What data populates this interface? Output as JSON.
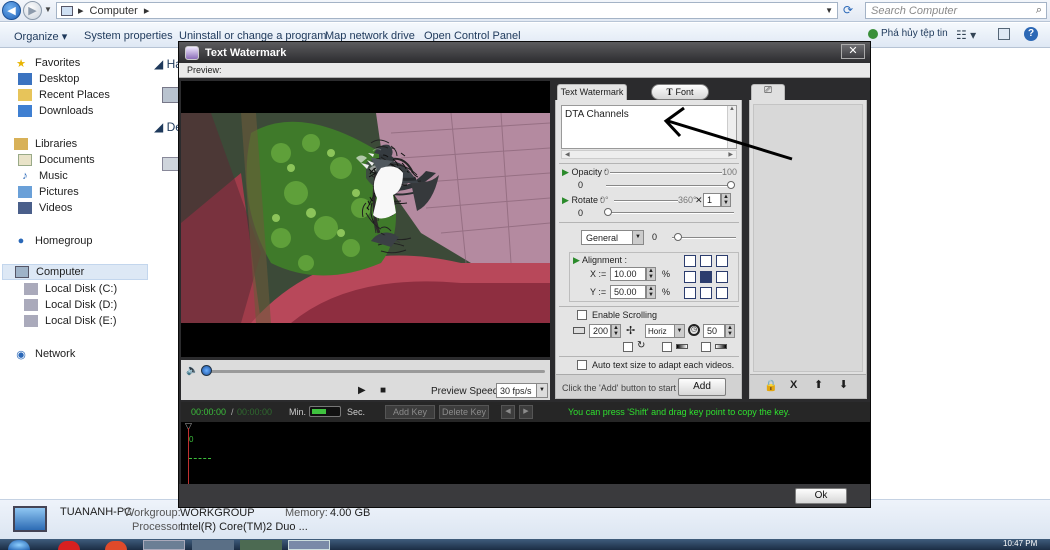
{
  "explorer": {
    "address": "Computer",
    "search_placeholder": "Search Computer",
    "commands": [
      "Organize",
      "System properties",
      "Uninstall or change a program",
      "Map network drive",
      "Open Control Panel"
    ],
    "right_command": "Phá hủy tệp tin",
    "sidebar": {
      "favorites": [
        "Favorites",
        "Desktop",
        "Recent Places",
        "Downloads"
      ],
      "libraries": [
        "Libraries",
        "Documents",
        "Music",
        "Pictures",
        "Videos"
      ],
      "homegroup": "Homegroup",
      "computer": [
        "Computer",
        "Local Disk (C:)",
        "Local Disk (D:)",
        "Local Disk (E:)"
      ],
      "network": "Network"
    },
    "content_headers": [
      "Ha",
      "De"
    ],
    "details": {
      "pc_name": "TUANANH-PC",
      "workgroup_label": "Workgroup:",
      "workgroup_value": "WORKGROUP",
      "memory_label": "Memory:",
      "memory_value": "4.00 GB",
      "processor_label": "Processor:",
      "processor_value": "Intel(R) Core(TM)2 Duo ..."
    },
    "clock": "10:47 PM"
  },
  "dialog": {
    "title": "Text Watermark",
    "menu_label": "Preview:",
    "preview_speed_label": "Preview Speed:",
    "preview_speed_value": "30 fps/s",
    "tabs": {
      "text": "Text Watermark",
      "font": "Font"
    },
    "text_value": "DTA Channels",
    "opacity": {
      "label": "Opacity :",
      "min": "0",
      "max": "100",
      "value": "0"
    },
    "rotate": {
      "label": "Rotate :",
      "min": "0°",
      "max": "360°",
      "multiplier": "1",
      "value": "0"
    },
    "general": {
      "select": "General",
      "value": "0"
    },
    "alignment": {
      "label": "Alignment :",
      "x_label": "X :=",
      "x_value": "10.00",
      "y_label": "Y :=",
      "y_value": "50.00",
      "unit": "%"
    },
    "scrolling": {
      "label": "Enable Scrolling",
      "length": "200",
      "direction": "Horiz",
      "speed": "50"
    },
    "auto_size_label": "Auto text size to adapt each videos.",
    "hint_add": "Click the 'Add' button to start ->",
    "add_button": "Add",
    "timeline": {
      "current": "00:00:00",
      "sep": "/",
      "total": "00:00:00",
      "min_label": "Min.",
      "sec_label": "Sec.",
      "add_key": "Add Key",
      "delete_key": "Delete Key",
      "hint": "You can press 'Shift' and drag key point to copy the key.",
      "track_zero": "0"
    },
    "ok_button": "Ok",
    "colors": {
      "hint_green": "#2fe02f",
      "time_green": "#3bbf3b",
      "dark_bg": "#2b2b2d"
    }
  }
}
